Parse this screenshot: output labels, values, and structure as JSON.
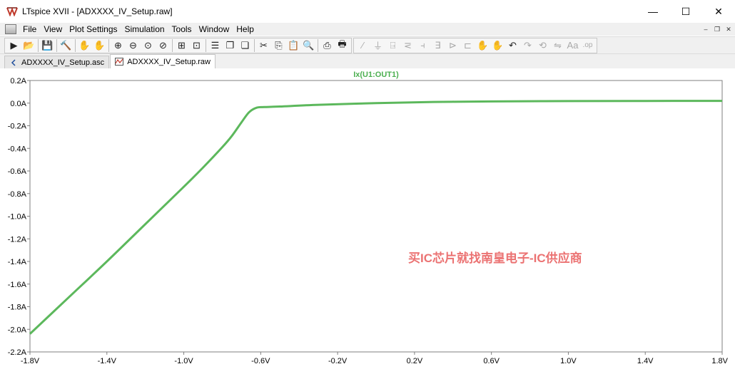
{
  "window": {
    "title": "LTspice XVII - [ADXXXX_IV_Setup.raw]",
    "controls": {
      "minimize": "—",
      "maximize": "☐",
      "close": "✕"
    }
  },
  "menu": {
    "items": [
      {
        "label": "File"
      },
      {
        "label": "View"
      },
      {
        "label": "Plot Settings"
      },
      {
        "label": "Simulation"
      },
      {
        "label": "Tools"
      },
      {
        "label": "Window"
      },
      {
        "label": "Help"
      }
    ],
    "mdi_controls": {
      "minimize": "–",
      "restore": "❐",
      "close": "✕"
    }
  },
  "toolbar": {
    "buttons": [
      {
        "icon": "run-icon",
        "glyph": "▶"
      },
      {
        "icon": "open-icon",
        "glyph": "📂"
      },
      {
        "icon": "save-icon",
        "glyph": "💾"
      },
      {
        "icon": "control-panel-icon",
        "glyph": "🔨"
      },
      {
        "icon": "probe-icon",
        "glyph": "✋"
      },
      {
        "icon": "pan-icon",
        "glyph": "✋"
      },
      {
        "icon": "zoom-in-icon",
        "glyph": "⊕"
      },
      {
        "icon": "zoom-out-icon",
        "glyph": "⊖"
      },
      {
        "icon": "zoom-full-icon",
        "glyph": "⊙"
      },
      {
        "icon": "zoom-cancel-icon",
        "glyph": "⊘"
      },
      {
        "icon": "autorange-icon",
        "glyph": "⊞"
      },
      {
        "icon": "mark-icon",
        "glyph": "⊡"
      },
      {
        "icon": "tile-horizontal-icon",
        "glyph": "☰"
      },
      {
        "icon": "cascade-icon",
        "glyph": "❐"
      },
      {
        "icon": "tile-vertical-icon",
        "glyph": "❏"
      },
      {
        "icon": "cut-icon",
        "glyph": "✂"
      },
      {
        "icon": "copy-icon",
        "glyph": "⎘"
      },
      {
        "icon": "paste-icon",
        "glyph": "📋"
      },
      {
        "icon": "find-icon",
        "glyph": "🔍"
      },
      {
        "icon": "print-preview-icon",
        "glyph": "⎙"
      },
      {
        "icon": "print-icon",
        "glyph": "🖶"
      },
      {
        "icon": "wire-icon",
        "glyph": "∕"
      },
      {
        "icon": "ground-icon",
        "glyph": "⏚"
      },
      {
        "icon": "label-icon",
        "glyph": "⍈"
      },
      {
        "icon": "resistor-icon",
        "glyph": "⋜"
      },
      {
        "icon": "capacitor-icon",
        "glyph": "⫞"
      },
      {
        "icon": "inductor-icon",
        "glyph": "∃"
      },
      {
        "icon": "diode-icon",
        "glyph": "⊳"
      },
      {
        "icon": "component-icon",
        "glyph": "⊏"
      },
      {
        "icon": "move-icon",
        "glyph": "✋"
      },
      {
        "icon": "drag-icon",
        "glyph": "✋"
      },
      {
        "icon": "undo-icon",
        "glyph": "↶"
      },
      {
        "icon": "redo-icon",
        "glyph": "↷"
      },
      {
        "icon": "rotate-icon",
        "glyph": "⟲"
      },
      {
        "icon": "mirror-icon",
        "glyph": "⇋"
      },
      {
        "icon": "text-icon",
        "glyph": "Aa"
      },
      {
        "icon": "spice-directive-icon",
        "glyph": ".op"
      }
    ]
  },
  "tabs": [
    {
      "label": "ADXXXX_IV_Setup.asc",
      "icon": "schematic-icon",
      "active": false
    },
    {
      "label": "ADXXXX_IV_Setup.raw",
      "icon": "waveform-icon",
      "active": true
    }
  ],
  "watermark": "买IC芯片就找南皇电子-IC供应商",
  "chart_data": {
    "type": "line",
    "title": "Ix(U1:OUT1)",
    "xlabel": "",
    "ylabel": "",
    "xlim": [
      -1.8,
      1.8
    ],
    "ylim": [
      -2.2,
      0.2
    ],
    "x_ticks": [
      "-1.8V",
      "-1.4V",
      "-1.0V",
      "-0.6V",
      "-0.2V",
      "0.2V",
      "0.6V",
      "1.0V",
      "1.4V",
      "1.8V"
    ],
    "x_tick_values": [
      -1.8,
      -1.4,
      -1.0,
      -0.6,
      -0.2,
      0.2,
      0.6,
      1.0,
      1.4,
      1.8
    ],
    "y_ticks": [
      "0.2A",
      "0.0A",
      "-0.2A",
      "-0.4A",
      "-0.6A",
      "-0.8A",
      "-1.0A",
      "-1.2A",
      "-1.4A",
      "-1.6A",
      "-1.8A",
      "-2.0A",
      "-2.2A"
    ],
    "y_tick_values": [
      0.2,
      0.0,
      -0.2,
      -0.4,
      -0.6,
      -0.8,
      -1.0,
      -1.2,
      -1.4,
      -1.6,
      -1.8,
      -2.0,
      -2.2
    ],
    "grid": false,
    "series": [
      {
        "name": "Ix(U1:OUT1)",
        "color": "#5cb85c",
        "x": [
          -1.8,
          -1.6,
          -1.4,
          -1.2,
          -1.0,
          -0.9,
          -0.8,
          -0.75,
          -0.7,
          -0.66,
          -0.62,
          -0.58,
          -0.5,
          -0.3,
          0.0,
          0.3,
          0.6,
          1.0,
          1.4,
          1.8
        ],
        "y": [
          -2.04,
          -1.72,
          -1.4,
          -1.07,
          -0.74,
          -0.57,
          -0.39,
          -0.29,
          -0.17,
          -0.08,
          -0.04,
          -0.035,
          -0.03,
          -0.015,
          0.0,
          0.01,
          0.015,
          0.018,
          0.019,
          0.02
        ]
      }
    ]
  }
}
